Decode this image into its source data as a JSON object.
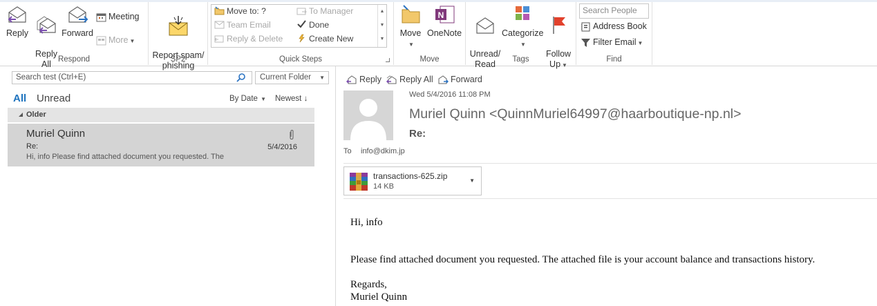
{
  "ribbon": {
    "respond": {
      "title": "Respond",
      "reply": "Reply",
      "reply_all": "Reply\nAll",
      "forward": "Forward",
      "meeting": "Meeting",
      "more": "More"
    },
    "sp2": {
      "title": "SP2",
      "report_spam": "Report spam/\nphishing"
    },
    "quick_steps": {
      "title": "Quick Steps",
      "move_to": "Move to: ?",
      "team_email": "Team Email",
      "reply_delete": "Reply & Delete",
      "to_manager": "To Manager",
      "done": "Done",
      "create_new": "Create New"
    },
    "move": {
      "title": "Move",
      "move": "Move",
      "onenote": "OneNote"
    },
    "tags": {
      "title": "Tags",
      "unread_read": "Unread/\nRead",
      "categorize": "Categorize",
      "follow_up": "Follow\nUp"
    },
    "find": {
      "title": "Find",
      "search_people_placeholder": "Search People",
      "address_book": "Address Book",
      "filter_email": "Filter Email"
    }
  },
  "list": {
    "search_placeholder": "Search test (Ctrl+E)",
    "scope": "Current Folder",
    "tab_all": "All",
    "tab_unread": "Unread",
    "sort_by": "By Date",
    "sort_order": "Newest",
    "group": "Older",
    "items": [
      {
        "sender": "Muriel Quinn",
        "subject": "Re:",
        "preview": "Hi, info  Please find attached document you requested. The",
        "date": "5/4/2016",
        "has_attachment": true
      }
    ]
  },
  "reading": {
    "actions": {
      "reply": "Reply",
      "reply_all": "Reply All",
      "forward": "Forward"
    },
    "sent": "Wed 5/4/2016 11:08 PM",
    "from": "Muriel Quinn <QuinnMuriel64997@haarboutique-np.nl>",
    "subject": "Re:",
    "to_label": "To",
    "to": "info@dkim.jp",
    "attachment": {
      "name": "transactions-625.zip",
      "size": "14 KB"
    },
    "body": [
      "Hi, info",
      "Please find attached document you requested. The attached file is your account balance and transactions history.",
      "Regards,",
      "Muriel Quinn"
    ]
  },
  "colors": {
    "accent": "#1e73be",
    "selected_row": "#d4d4d4",
    "group_header": "#e4e4e4"
  }
}
